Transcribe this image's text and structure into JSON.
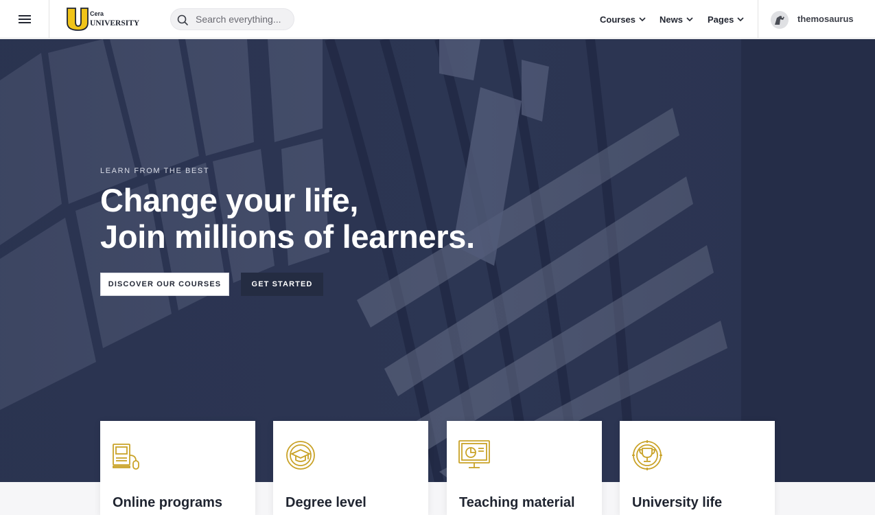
{
  "header": {
    "logo": {
      "line1": "Cera",
      "line2": "UNIVERSITY",
      "mark": "U"
    },
    "search": {
      "placeholder": "Search everything..."
    },
    "nav": [
      {
        "label": "Courses"
      },
      {
        "label": "News"
      },
      {
        "label": "Pages"
      }
    ],
    "user": {
      "name": "themosaurus"
    }
  },
  "hero": {
    "eyebrow": "LEARN FROM THE BEST",
    "headline_line1": "Change your life,",
    "headline_line2": "Join millions of learners.",
    "primary_button": "DISCOVER OUR COURSES",
    "secondary_button": "GET STARTED"
  },
  "cards": [
    {
      "title": "Online programs",
      "icon": "online-programs-icon"
    },
    {
      "title": "Degree level",
      "icon": "graduation-cap-icon"
    },
    {
      "title": "Teaching material",
      "icon": "teaching-material-icon"
    },
    {
      "title": "University life",
      "icon": "trophy-icon"
    }
  ],
  "colors": {
    "accent": "#c9a227",
    "hero_overlay": "#2c3550",
    "dark_button": "#242c42",
    "text_dark": "#1f2430"
  }
}
